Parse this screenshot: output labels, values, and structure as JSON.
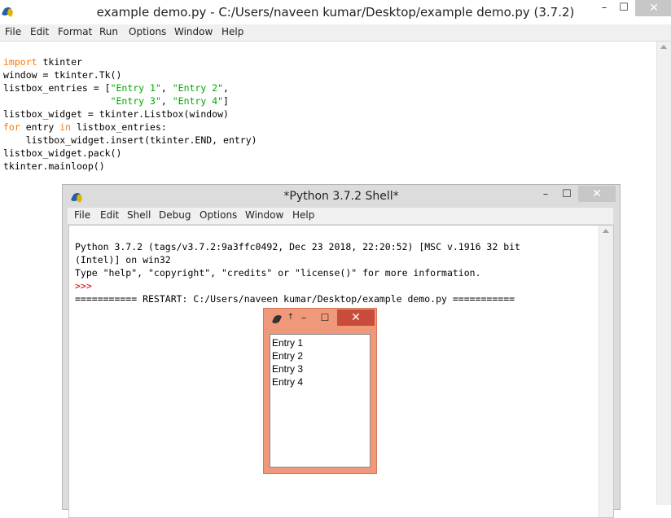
{
  "editor": {
    "title": "example demo.py - C:/Users/naveen kumar/Desktop/example demo.py (3.7.2)",
    "menu": [
      "File",
      "Edit",
      "Format",
      "Run",
      "Options",
      "Window",
      "Help"
    ],
    "code": [
      {
        "kw": "import",
        "rest": " tkinter"
      },
      {
        "text": "window = tkinter.Tk()"
      },
      {
        "pre": "listbox_entries = [",
        "s1": "\"Entry 1\"",
        "mid": ", ",
        "s2": "\"Entry 2\"",
        "post": ","
      },
      {
        "pre": "                   ",
        "s1": "\"Entry 3\"",
        "mid": ", ",
        "s2": "\"Entry 4\"",
        "post": "]"
      },
      {
        "text": "listbox_widget = tkinter.Listbox(window)"
      },
      {
        "kw": "for",
        "mid": " entry ",
        "kw2": "in",
        "rest": " listbox_entries:"
      },
      {
        "text": "    listbox_widget.insert(tkinter.END, entry)"
      },
      {
        "text": "listbox_widget.pack()"
      },
      {
        "text": "tkinter.mainloop()"
      }
    ]
  },
  "shell": {
    "title": "*Python 3.7.2 Shell*",
    "menu": [
      "File",
      "Edit",
      "Shell",
      "Debug",
      "Options",
      "Window",
      "Help"
    ],
    "lines": [
      "Python 3.7.2 (tags/v3.7.2:9a3ffc0492, Dec 23 2018, 22:20:52) [MSC v.1916 32 bit",
      "(Intel)] on win32",
      "Type \"help\", \"copyright\", \"credits\" or \"license()\" for more information.",
      ">>> ",
      "=========== RESTART: C:/Users/naveen kumar/Desktop/example demo.py ==========="
    ]
  },
  "tk_window": {
    "title_glyph": "↑",
    "items": [
      "Entry 1",
      "Entry 2",
      "Entry 3",
      "Entry 4"
    ]
  },
  "window_controls": {
    "minimize": "–",
    "maximize": "☐",
    "close": "✕"
  }
}
